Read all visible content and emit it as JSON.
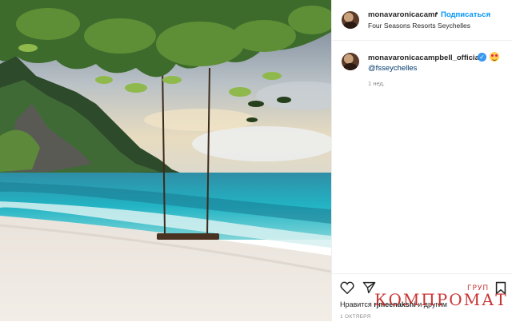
{
  "post": {
    "header": {
      "username": "monavaronicacamı",
      "dot": "•",
      "follow_label": "Подписаться",
      "location": "Four Seasons Resorts Seychelles"
    },
    "caption": {
      "username": "monavaronicacampbell_official",
      "verified_icon": "verified-badge-icon",
      "emoji_icon": "heart-eyes-emoji-icon",
      "mention": "@fsseychelles",
      "time_ago": "1 нед."
    },
    "actions": {
      "like_icon": "heart-icon",
      "share_icon": "paper-plane-icon",
      "save_icon": "bookmark-icon"
    },
    "likes": {
      "prefix": "Нравится",
      "user": "rjmeenakshi",
      "suffix": "и другим"
    },
    "date": "1 ОКТЯБРЯ"
  },
  "watermark": {
    "text": "КОМПРОМАТ",
    "small": "ГРУП",
    "color": "#c41e1e"
  },
  "colors": {
    "link_blue": "#0095f6",
    "mention_blue": "#00376b",
    "muted": "#8e8e8e"
  }
}
